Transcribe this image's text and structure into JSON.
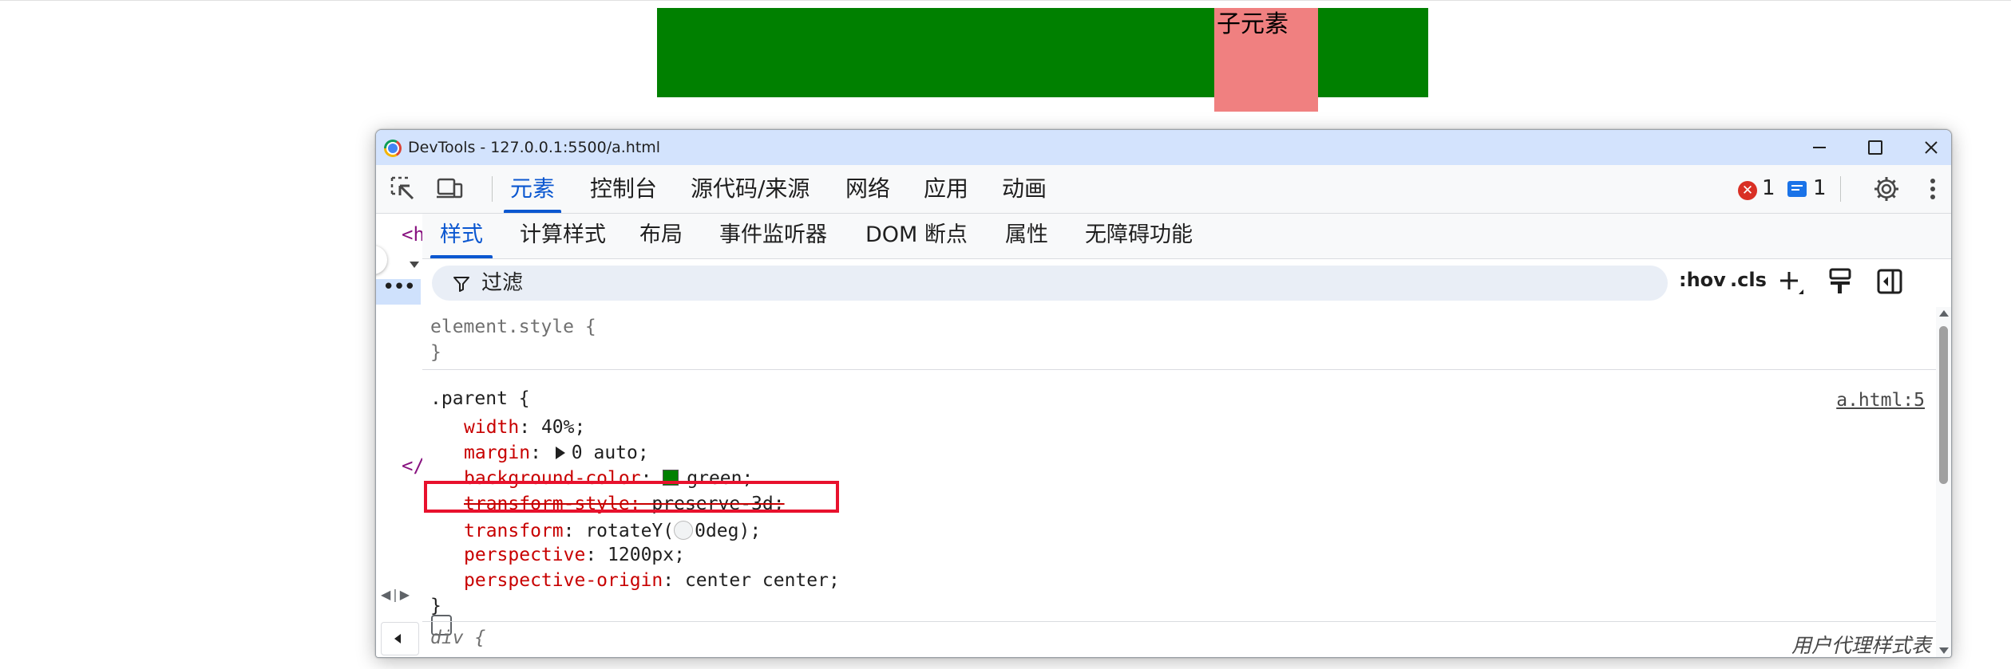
{
  "page": {
    "child_label": "子元素",
    "colors": {
      "parent_bg": "#008000",
      "child_bg": "#f08080"
    }
  },
  "window": {
    "title": "DevTools - 127.0.0.1:5500/a.html"
  },
  "main_tabs": [
    {
      "label": "元素",
      "active": true
    },
    {
      "label": "控制台",
      "active": false
    },
    {
      "label": "源代码/来源",
      "active": false
    },
    {
      "label": "网络",
      "active": false
    },
    {
      "label": "应用",
      "active": false
    },
    {
      "label": "动画",
      "active": false
    }
  ],
  "status": {
    "errors": "1",
    "messages": "1"
  },
  "left_panel": {
    "tag_open": "<h",
    "tag_close": "</",
    "ellipsis": "•••"
  },
  "sub_tabs": [
    {
      "label": "样式",
      "active": true
    },
    {
      "label": "计算样式",
      "active": false
    },
    {
      "label": "布局",
      "active": false
    },
    {
      "label": "事件监听器",
      "active": false
    },
    {
      "label": "DOM 断点",
      "active": false
    },
    {
      "label": "属性",
      "active": false
    },
    {
      "label": "无障碍功能",
      "active": false
    }
  ],
  "filter": {
    "placeholder": "过滤",
    "hov": ":hov",
    "cls": ".cls"
  },
  "styles": {
    "element_style": {
      "selector": "element.style {",
      "close": "}"
    },
    "parent_rule": {
      "selector": ".parent {",
      "source": "a.html:5",
      "close": "}",
      "decls": [
        {
          "prop": "width",
          "value": "40%;",
          "struck": false
        },
        {
          "prop": "margin",
          "value": "0 auto;",
          "struck": false
        },
        {
          "prop": "background-color",
          "value": "green;",
          "struck": false
        },
        {
          "prop": "transform-style",
          "value": "preserve-3d;",
          "struck": true
        },
        {
          "prop": "transform",
          "value": "rotateY(",
          "value_after": "0deg);",
          "struck": false
        },
        {
          "prop": "perspective",
          "value": "1200px;",
          "struck": false
        },
        {
          "prop": "perspective-origin",
          "value": "center center;",
          "struck": false
        }
      ]
    },
    "div_rule": {
      "selector": "div {",
      "source": "用户代理样式表"
    },
    "swatch_color": "#008000",
    "highlight_color": "#e8112d"
  }
}
